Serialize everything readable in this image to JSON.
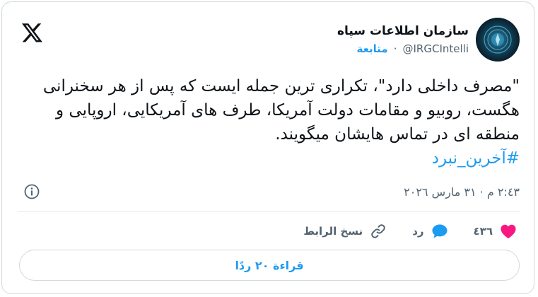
{
  "tweet": {
    "display_name": "سازمان اطلاعات سپاه",
    "handle": "@IRGCIntelli",
    "separator": "·",
    "follow_label": "متابعة",
    "text": "\"مصرف داخلی دارد\"، تکراری ترین جمله ایست که پس از هر سخنرانی هگست، روبیو و مقامات دولت آمریکا، طرف های آمریکایی، اروپایی و منطقه ای در تماس هایشان میگویند.",
    "hashtag": "#آخرین_نبرد",
    "timestamp": "٢:٤٣ م · ٣١ مارس ٢٠٢٦"
  },
  "actions": {
    "likes_count": "٤٣٦",
    "reply_label": "رد",
    "copy_link_label": "نسخ الرابط"
  },
  "read_replies_label": "قراءة ٢٠ ردًا",
  "icons": {
    "brand": "x-logo-icon",
    "info": "info-icon",
    "like": "heart-icon",
    "reply": "speech-bubble-icon",
    "copy_link": "link-icon"
  },
  "colors": {
    "accent": "#1d9bf0",
    "like": "#f91880",
    "muted": "#536471",
    "text": "#0f1419",
    "border": "#cfd9de"
  }
}
